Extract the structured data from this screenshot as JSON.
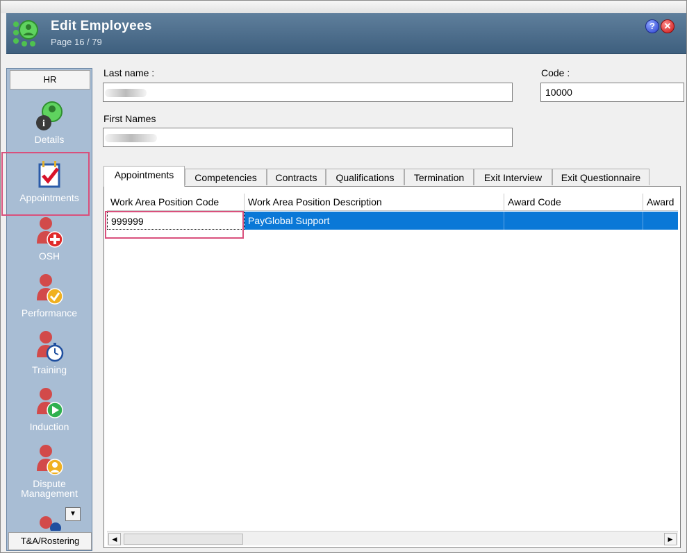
{
  "window": {
    "title": "Edit Employees",
    "page_info": "Page 16 / 79",
    "help_label": "?",
    "close_label": "✕"
  },
  "sidebar": {
    "header": "HR",
    "footer": "T&A/Rostering",
    "items": [
      {
        "label": "Details",
        "icon": "details-icon"
      },
      {
        "label": "Appointments",
        "icon": "calendar-check-icon"
      },
      {
        "label": "OSH",
        "icon": "osh-plus-icon"
      },
      {
        "label": "Performance",
        "icon": "performance-check-icon"
      },
      {
        "label": "Training",
        "icon": "stopwatch-icon"
      },
      {
        "label": "Induction",
        "icon": "play-icon"
      },
      {
        "label": "Dispute",
        "label2": "Management",
        "icon": "dispute-person-icon"
      }
    ],
    "scroll_glyph": "▼"
  },
  "form": {
    "last_name_label": "Last name :",
    "last_name_value": "",
    "code_label": "Code :",
    "code_value": "10000",
    "first_names_label": "First Names",
    "first_names_value": ""
  },
  "tabs": [
    {
      "label": "Appointments",
      "active": true
    },
    {
      "label": "Competencies"
    },
    {
      "label": "Contracts"
    },
    {
      "label": "Qualifications"
    },
    {
      "label": "Termination"
    },
    {
      "label": "Exit Interview"
    },
    {
      "label": "Exit Questionnaire"
    }
  ],
  "grid": {
    "columns": [
      "Work Area Position Code",
      "Work Area Position Description",
      "Award Code",
      "Award"
    ],
    "rows": [
      [
        "999999",
        "PayGlobal Support",
        "",
        ""
      ]
    ],
    "scroll_left": "◀",
    "scroll_right": "▶"
  },
  "colors": {
    "title_bar": "#4a6a8a",
    "sidebar_bg": "#a8bdd4",
    "selection": "#0a78d7",
    "highlight": "#d9507c"
  }
}
